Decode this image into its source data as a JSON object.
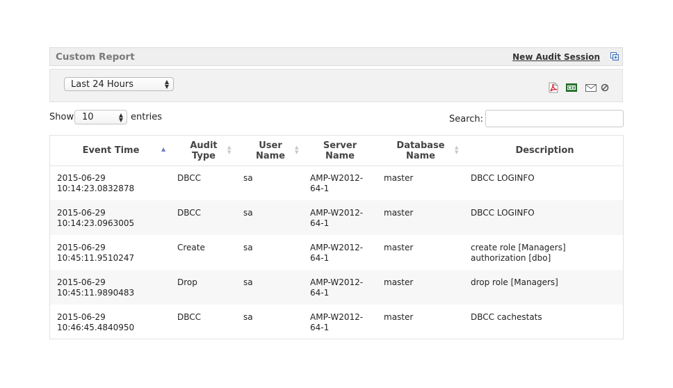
{
  "panel": {
    "title": "Custom Report",
    "new_session_label": "New Audit Session"
  },
  "toolbar": {
    "time_range": "Last 24 Hours",
    "icons": [
      "pdf-icon",
      "csv-icon",
      "email-icon",
      "cancel-icon"
    ]
  },
  "controls": {
    "show_label": "Show",
    "page_length": "10",
    "entries_label": "entries",
    "search_label": "Search:",
    "search_value": ""
  },
  "table": {
    "headers": [
      "Event Time",
      "Audit Type",
      "User Name",
      "Server Name",
      "Database Name",
      "Description"
    ],
    "sorted_column": "Event Time",
    "sort_direction": "ascending",
    "rows": [
      {
        "event_time": "2015-06-29 10:14:23.0832878",
        "audit_type": "DBCC",
        "user_name": "sa",
        "server_name": "AMP-W2012-64-1",
        "database_name": "master",
        "description": "DBCC LOGINFO"
      },
      {
        "event_time": "2015-06-29 10:14:23.0963005",
        "audit_type": "DBCC",
        "user_name": "sa",
        "server_name": "AMP-W2012-64-1",
        "database_name": "master",
        "description": "DBCC LOGINFO"
      },
      {
        "event_time": "2015-06-29 10:45:11.9510247",
        "audit_type": "Create",
        "user_name": "sa",
        "server_name": "AMP-W2012-64-1",
        "database_name": "master",
        "description": "create role [Managers] authorization [dbo]"
      },
      {
        "event_time": "2015-06-29 10:45:11.9890483",
        "audit_type": "Drop",
        "user_name": "sa",
        "server_name": "AMP-W2012-64-1",
        "database_name": "master",
        "description": "drop role [Managers]"
      },
      {
        "event_time": "2015-06-29 10:46:45.4840950",
        "audit_type": "DBCC",
        "user_name": "sa",
        "server_name": "AMP-W2012-64-1",
        "database_name": "master",
        "description": "DBCC cachestats"
      }
    ]
  }
}
